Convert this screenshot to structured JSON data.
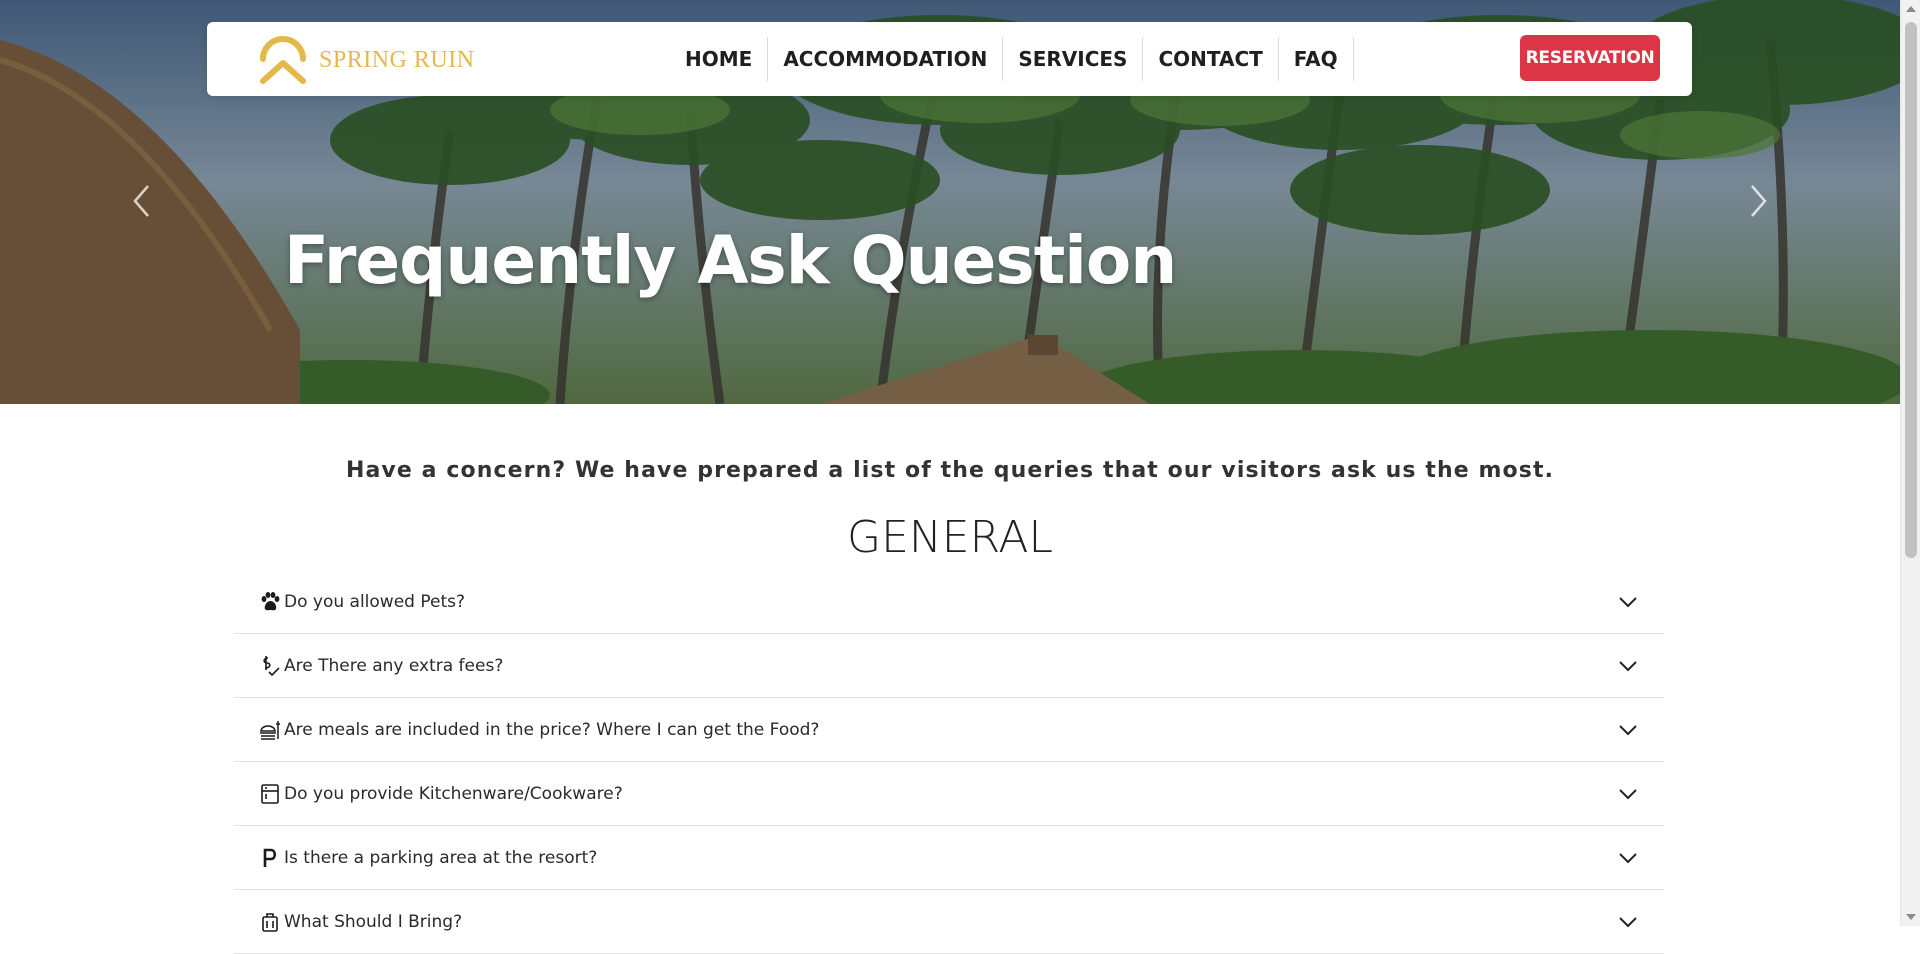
{
  "brand": {
    "name": "SPRING RUIN",
    "logo_icon": "chevron-arch-logo",
    "color": "#e5b84a"
  },
  "nav": {
    "items": [
      {
        "label": "HOME"
      },
      {
        "label": "ACCOMMODATION"
      },
      {
        "label": "SERVICES"
      },
      {
        "label": "CONTACT"
      },
      {
        "label": "FAQ"
      }
    ],
    "reservation_label": "RESERVATION",
    "reservation_color": "#dc3545"
  },
  "hero": {
    "title": "Frequently Ask Question",
    "prev_icon": "chevron-left-icon",
    "next_icon": "chevron-right-icon"
  },
  "intro": "Have a concern? We have prepared a list of the queries that our visitors ask us the most.",
  "section_heading": "GENERAL",
  "faq": [
    {
      "icon": "paw-icon",
      "question": "Do you allowed Pets?"
    },
    {
      "icon": "dollar-check-icon",
      "question": "Are There any extra fees?"
    },
    {
      "icon": "meal-icon",
      "question": "Are meals are included in the price? Where I can get the Food?"
    },
    {
      "icon": "kitchen-icon",
      "question": "Do you provide Kitchenware/Cookware?"
    },
    {
      "icon": "parking-icon",
      "question": "Is there a parking area at the resort?"
    },
    {
      "icon": "luggage-icon",
      "question": "What Should I Bring?"
    }
  ]
}
